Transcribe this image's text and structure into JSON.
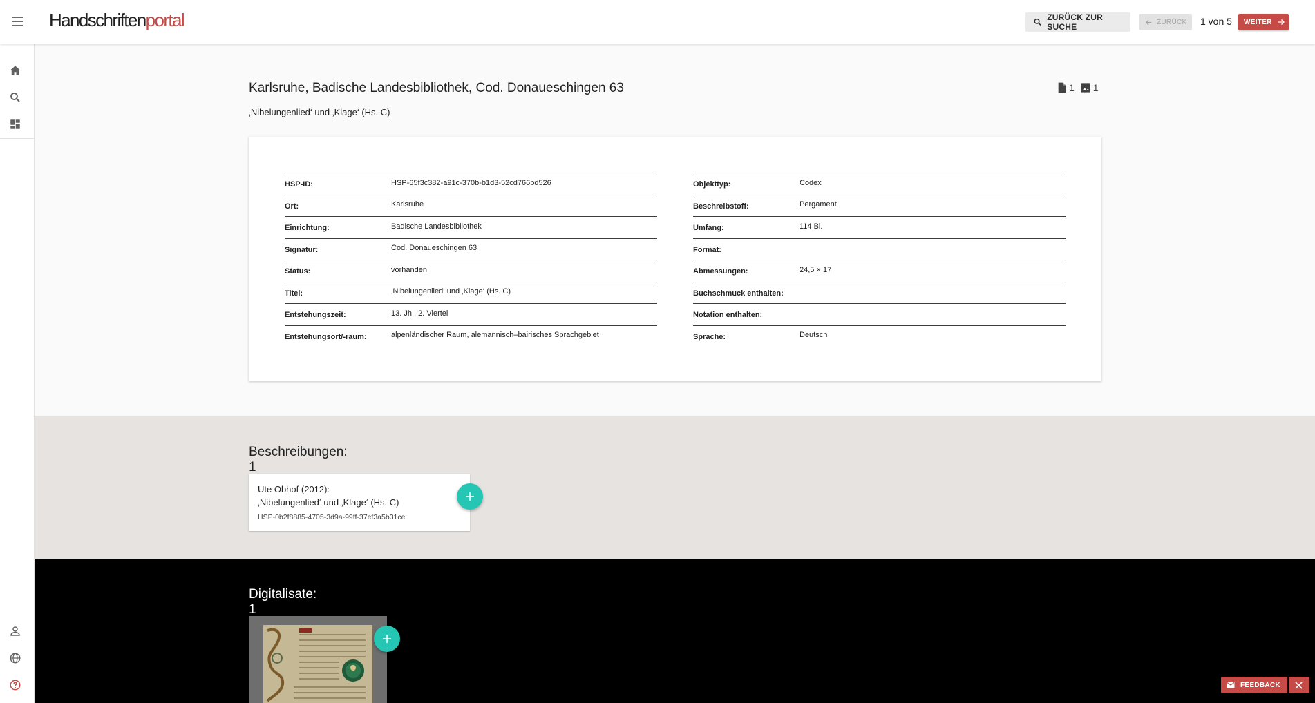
{
  "header": {
    "logo_part1": "Handschriften",
    "logo_part2": "portal",
    "back_to_search_label": "ZURÜCK ZUR SUCHE",
    "back_label": "ZURÜCK",
    "pager_text": "1 von 5",
    "next_label": "WEITER"
  },
  "record": {
    "title": "Karlsruhe, Badische Landesbibliothek, Cod. Donaueschingen 63",
    "subtitle": "‚Nibelungenlied‘ und ‚Klage‘ (Hs. C)",
    "description_count": "1",
    "image_count": "1"
  },
  "metadata_left": [
    {
      "label": "HSP-ID:",
      "value": "HSP-65f3c382-a91c-370b-b1d3-52cd766bd526"
    },
    {
      "label": "Ort:",
      "value": "Karlsruhe"
    },
    {
      "label": "Einrichtung:",
      "value": "Badische Landesbibliothek"
    },
    {
      "label": "Signatur:",
      "value": "Cod. Donaueschingen 63"
    },
    {
      "label": "Status:",
      "value": "vorhanden"
    },
    {
      "label": "Titel:",
      "value": "‚Nibelungenlied‘ und ‚Klage‘ (Hs. C)"
    },
    {
      "label": "Entstehungszeit:",
      "value": "13. Jh., 2. Viertel"
    },
    {
      "label": "Entstehungsort/-raum:",
      "value": "alpenländischer Raum, alemannisch–bairisches Sprachgebiet"
    }
  ],
  "metadata_right": [
    {
      "label": "Objekttyp:",
      "value": "Codex"
    },
    {
      "label": "Beschreibstoff:",
      "value": "Pergament"
    },
    {
      "label": "Umfang:",
      "value": "114 Bl."
    },
    {
      "label": "Format:",
      "value": ""
    },
    {
      "label": "Abmessungen:",
      "value": "24,5 × 17"
    },
    {
      "label": "Buchschmuck enthalten:",
      "value": ""
    },
    {
      "label": "Notation enthalten:",
      "value": ""
    },
    {
      "label": "Sprache:",
      "value": "Deutsch"
    }
  ],
  "descriptions": {
    "section_title": "Beschreibungen: 1",
    "items": [
      {
        "author_year": "Ute Obhof (2012):",
        "title": "‚Nibelungenlied‘ und ‚Klage‘ (Hs. C)",
        "id": "HSP-0b2f8885-4705-3d9a-99ff-37ef3a5b31ce"
      }
    ]
  },
  "digitalisate": {
    "section_title": "Digitalisate: 1"
  },
  "feedback": {
    "label": "FEEDBACK"
  },
  "colors": {
    "accent": "#c64a45",
    "fab": "#26c6b4",
    "descriptions_bg": "#e6e3e0",
    "digitalisate_bg": "#000000"
  },
  "icons": {
    "menu": "hamburger-menu-icon",
    "home": "home-icon",
    "search": "search-icon",
    "dashboard": "dashboard-icon",
    "account": "person-icon",
    "language": "globe-icon",
    "help": "help-icon",
    "description": "document-icon",
    "image": "image-icon",
    "add": "plus-icon",
    "mail": "mail-icon",
    "close": "close-icon"
  }
}
